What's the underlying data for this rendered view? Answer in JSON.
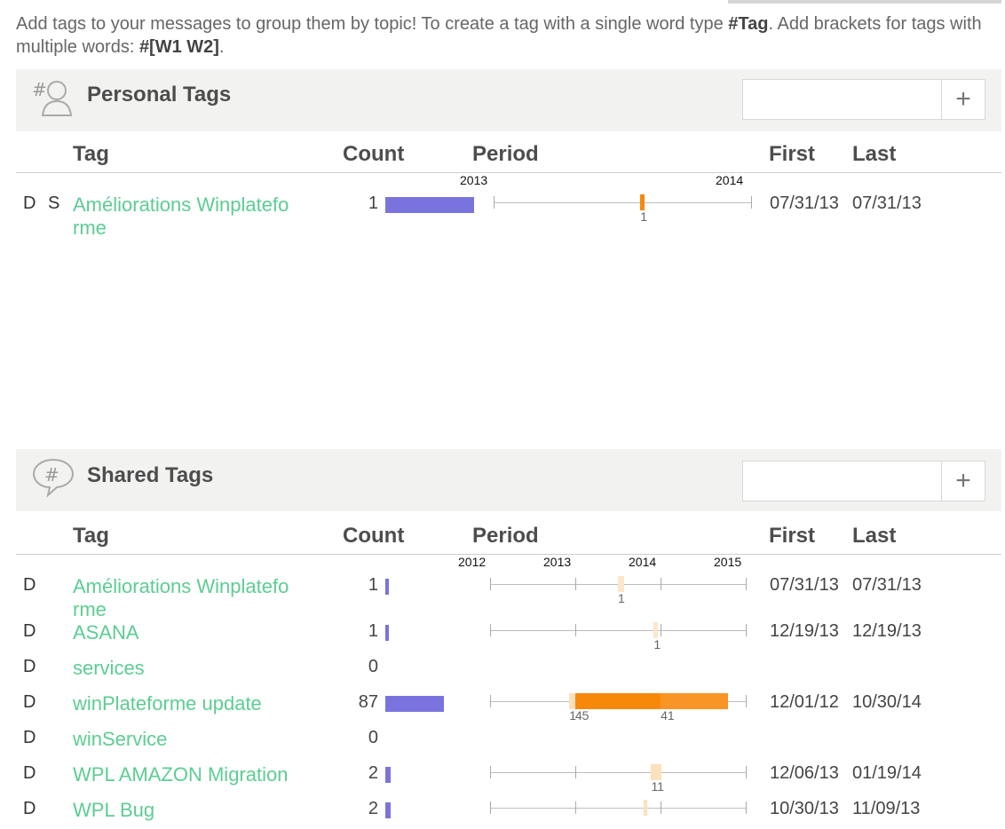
{
  "intro": {
    "part1": "Add tags to your messages to group them by topic! To create a tag with a single word type ",
    "example1": "#Tag",
    "part2": ". Add brackets for tags with multiple words: ",
    "example2": "#[W1 W2]",
    "part3": "."
  },
  "columns": {
    "tag": "Tag",
    "count": "Count",
    "period": "Period",
    "first": "First",
    "last": "Last"
  },
  "personal": {
    "title": "Personal Tags",
    "icon": "personal-tags-icon",
    "add_placeholder": "",
    "add_label": "+",
    "years": [
      "2013",
      "2014"
    ],
    "rows": [
      {
        "d": "D",
        "s": "S",
        "tag": "Améliorations Winplatefo rme",
        "count": "1",
        "count_fraction": 1.0,
        "first": "07/31/13",
        "last": "07/31/13",
        "marks": [
          {
            "label": "1",
            "start": 0.57,
            "end": 0.585,
            "color": "#f7890a"
          }
        ]
      }
    ]
  },
  "shared": {
    "title": "Shared Tags",
    "icon": "shared-tags-icon",
    "add_placeholder": "",
    "add_label": "+",
    "years": [
      "2012",
      "2013",
      "2014",
      "2015"
    ],
    "rows": [
      {
        "d": "D",
        "tag": "Améliorations Winplatefo rme",
        "count": "1",
        "count_fraction": 0.04,
        "first": "07/31/13",
        "last": "07/31/13",
        "marks": [
          {
            "label": "1",
            "start": 0.5,
            "end": 0.525,
            "color": "#fde6cc"
          }
        ]
      },
      {
        "d": "D",
        "tag": "ASANA",
        "count": "1",
        "count_fraction": 0.04,
        "first": "12/19/13",
        "last": "12/19/13",
        "marks": [
          {
            "label": "1",
            "start": 0.64,
            "end": 0.655,
            "color": "#fde6cc"
          }
        ]
      },
      {
        "d": "D",
        "tag": "services",
        "count": "0",
        "count_fraction": 0,
        "first": "",
        "last": "",
        "marks": []
      },
      {
        "d": "D",
        "tag": "winPlateforme update",
        "count": "87",
        "count_fraction": 0.66,
        "first": "12/01/12",
        "last": "10/30/14",
        "marks": [
          {
            "label": "1",
            "start": 0.31,
            "end": 0.333,
            "color": "#fde0bd"
          },
          {
            "label": "45",
            "start": 0.333,
            "end": 0.667,
            "color": "#f7890a"
          },
          {
            "label": "41",
            "start": 0.667,
            "end": 0.93,
            "color": "#f99524"
          }
        ]
      },
      {
        "d": "D",
        "tag": "winService",
        "count": "0",
        "count_fraction": 0,
        "first": "",
        "last": "",
        "marks": []
      },
      {
        "d": "D",
        "tag": "WPL AMAZON Migration",
        "count": "2",
        "count_fraction": 0.06,
        "first": "12/06/13",
        "last": "01/19/14",
        "marks": [
          {
            "label": "11",
            "start": 0.63,
            "end": 0.67,
            "color": "#fde0bd"
          }
        ]
      },
      {
        "d": "D",
        "tag": "WPL Bug",
        "count": "2",
        "count_fraction": 0.06,
        "first": "10/30/13",
        "last": "11/09/13",
        "marks": [
          {
            "label": "",
            "start": 0.6,
            "end": 0.615,
            "color": "#fde0bd"
          }
        ]
      }
    ]
  }
}
